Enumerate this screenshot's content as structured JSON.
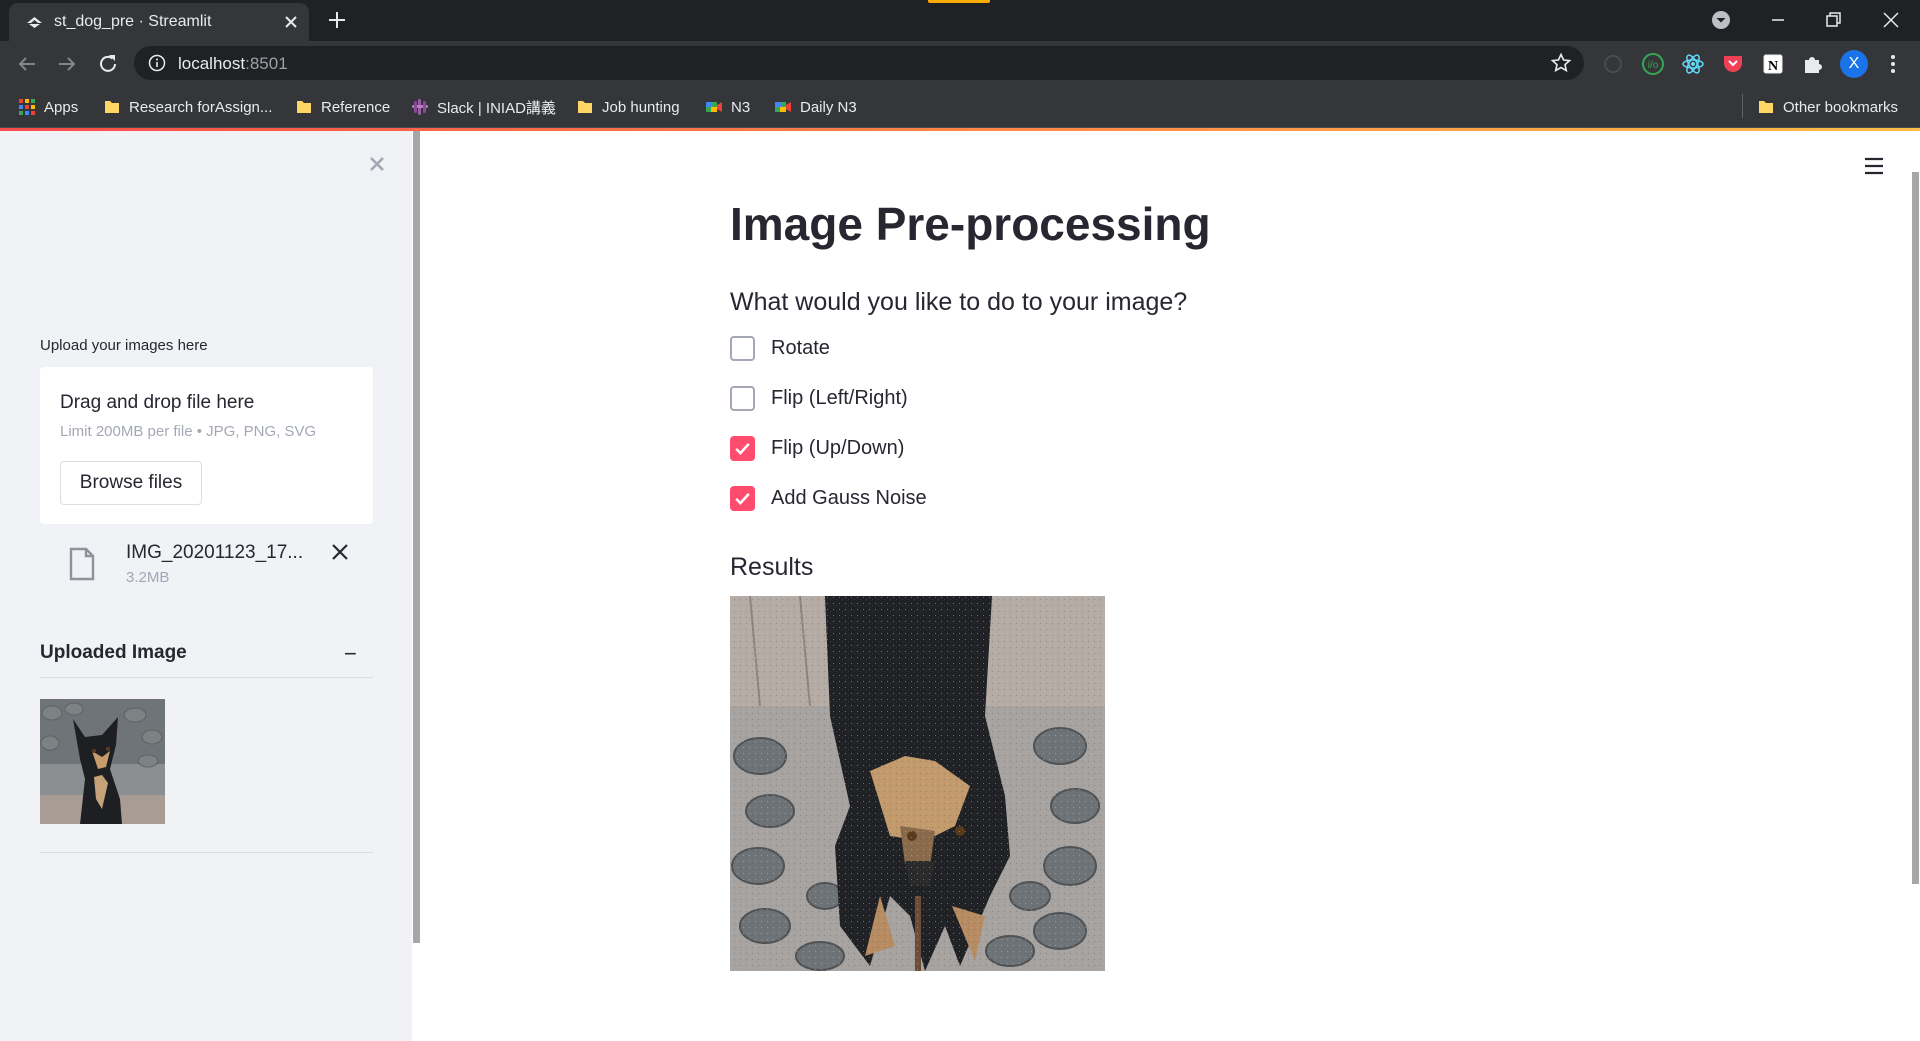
{
  "browser": {
    "tab_title": "st_dog_pre · Streamlit",
    "url_host": "localhost",
    "url_port": ":8501",
    "bookmarks": [
      "Apps",
      "Research forAssign...",
      "Reference",
      "Slack | INIAD講義",
      "Job hunting",
      "N3",
      "Daily N3"
    ],
    "other_bookmarks": "Other bookmarks",
    "profile_initial": "X"
  },
  "sidebar": {
    "upload_label": "Upload your images here",
    "dropzone_title": "Drag and drop file here",
    "dropzone_limit": "Limit 200MB per file • JPG, PNG, SVG",
    "browse_label": "Browse files",
    "file": {
      "name": "IMG_20201123_17...",
      "size": "3.2MB"
    },
    "expander_title": "Uploaded Image",
    "expander_toggle": "−"
  },
  "main": {
    "title": "Image Pre-processing",
    "question": "What would you like to do to your image?",
    "options": [
      {
        "label": "Rotate",
        "checked": false
      },
      {
        "label": "Flip (Left/Right)",
        "checked": false
      },
      {
        "label": "Flip (Up/Down)",
        "checked": true
      },
      {
        "label": "Add Gauss Noise",
        "checked": true
      }
    ],
    "results_label": "Results"
  },
  "colors": {
    "accent": "#ff4b6e",
    "chrome_dark": "#202124",
    "chrome_mid": "#35363a",
    "sidebar_bg": "#f0f2f6"
  }
}
